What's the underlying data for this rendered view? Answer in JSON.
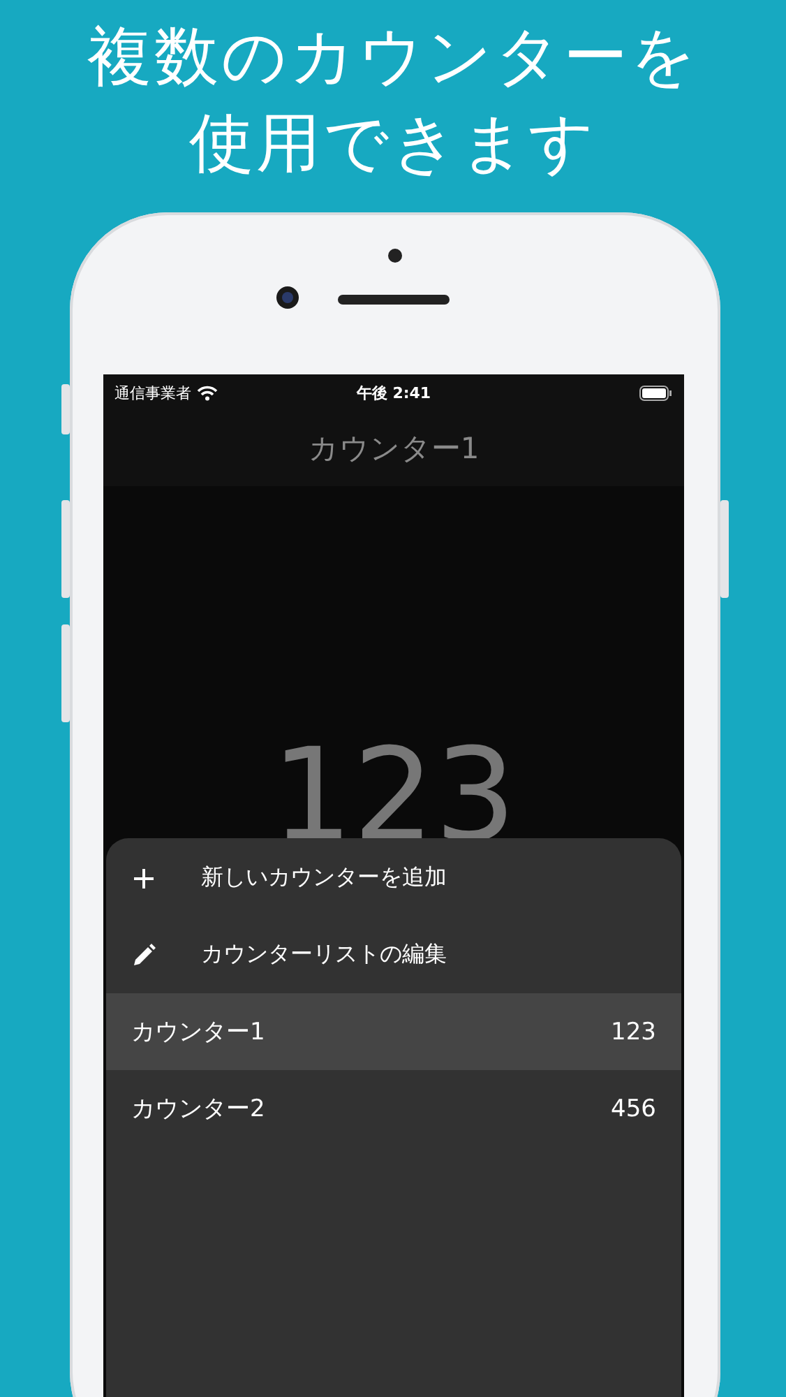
{
  "headline": [
    "複数のカウンターを",
    "使用できます"
  ],
  "status_bar": {
    "carrier": "通信事業者",
    "time": "午後 2:41"
  },
  "nav": {
    "title": "カウンター1"
  },
  "counter_value": "123",
  "menu": {
    "actions": [
      {
        "kind": "add",
        "label": "新しいカウンターを追加"
      },
      {
        "kind": "edit",
        "label": "カウンターリストの編集"
      }
    ],
    "counters": [
      {
        "name": "カウンター1",
        "value": "123",
        "selected": true
      },
      {
        "name": "カウンター2",
        "value": "456",
        "selected": false
      }
    ]
  }
}
